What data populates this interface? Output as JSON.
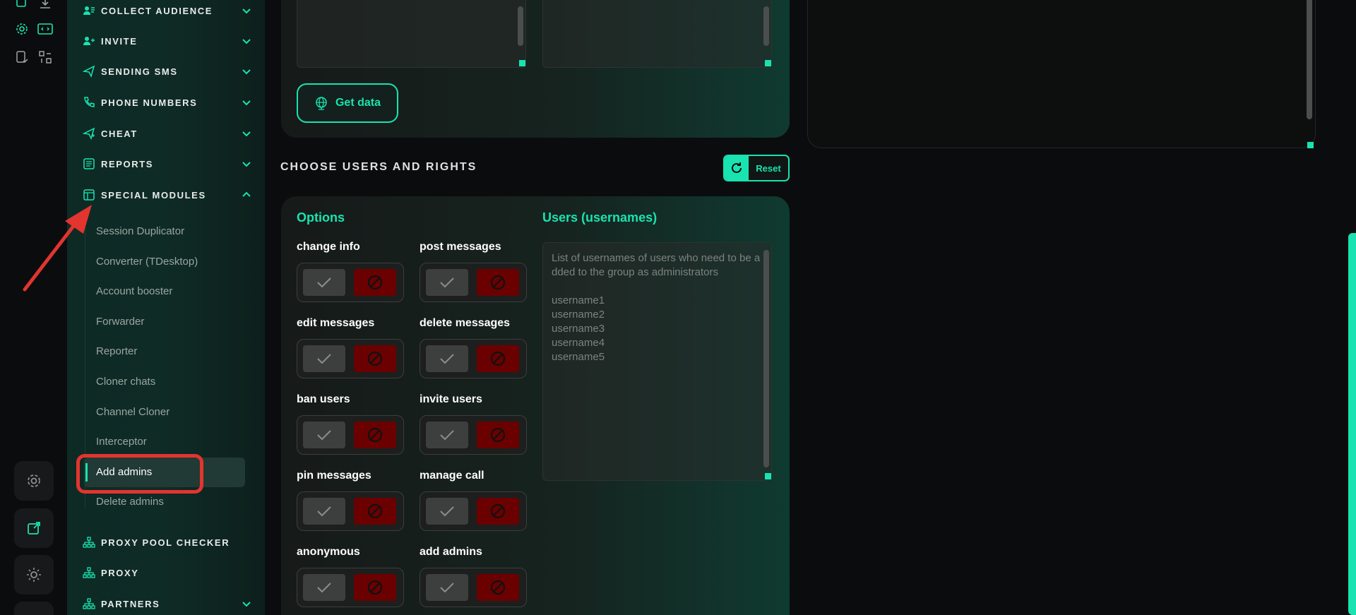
{
  "sidebar": {
    "sections": [
      {
        "label": "COLLECT AUDIENCE",
        "icon": "users-icon"
      },
      {
        "label": "INVITE",
        "icon": "user-add-icon"
      },
      {
        "label": "SENDING SMS",
        "icon": "send-icon"
      },
      {
        "label": "PHONE NUMBERS",
        "icon": "phone-icon"
      },
      {
        "label": "CHEAT",
        "icon": "send-plus-icon"
      },
      {
        "label": "REPORTS",
        "icon": "report-icon"
      },
      {
        "label": "SPECIAL MODULES",
        "icon": "modules-icon"
      }
    ],
    "special_modules": [
      "Session Duplicator",
      "Converter (TDesktop)",
      "Account booster",
      "Forwarder",
      "Reporter",
      "Cloner chats",
      "Channel Cloner",
      "Interceptor",
      "Add admins",
      "Delete admins"
    ],
    "bottom_sections": [
      {
        "label": "PROXY POOL CHECKER",
        "icon": "network-icon"
      },
      {
        "label": "PROXY",
        "icon": "network-icon"
      },
      {
        "label": "PARTNERS",
        "icon": "network-icon"
      }
    ]
  },
  "main": {
    "get_data_label": "Get data",
    "section_title": "CHOOSE USERS AND RIGHTS",
    "reset_label": "Reset",
    "options_title": "Options",
    "users_title": "Users (usernames)",
    "options": [
      "change info",
      "post messages",
      "edit messages",
      "delete messages",
      "ban users",
      "invite users",
      "pin messages",
      "manage call",
      "anonymous",
      "add admins"
    ],
    "users_placeholder": "List of usernames of users who need to be added to the group as administrators\n\nusername1\nusername2\nusername3\nusername4\nusername5"
  },
  "colors": {
    "accent": "#19e3b0",
    "deny": "#6b0000",
    "highlight": "#e3342f"
  }
}
